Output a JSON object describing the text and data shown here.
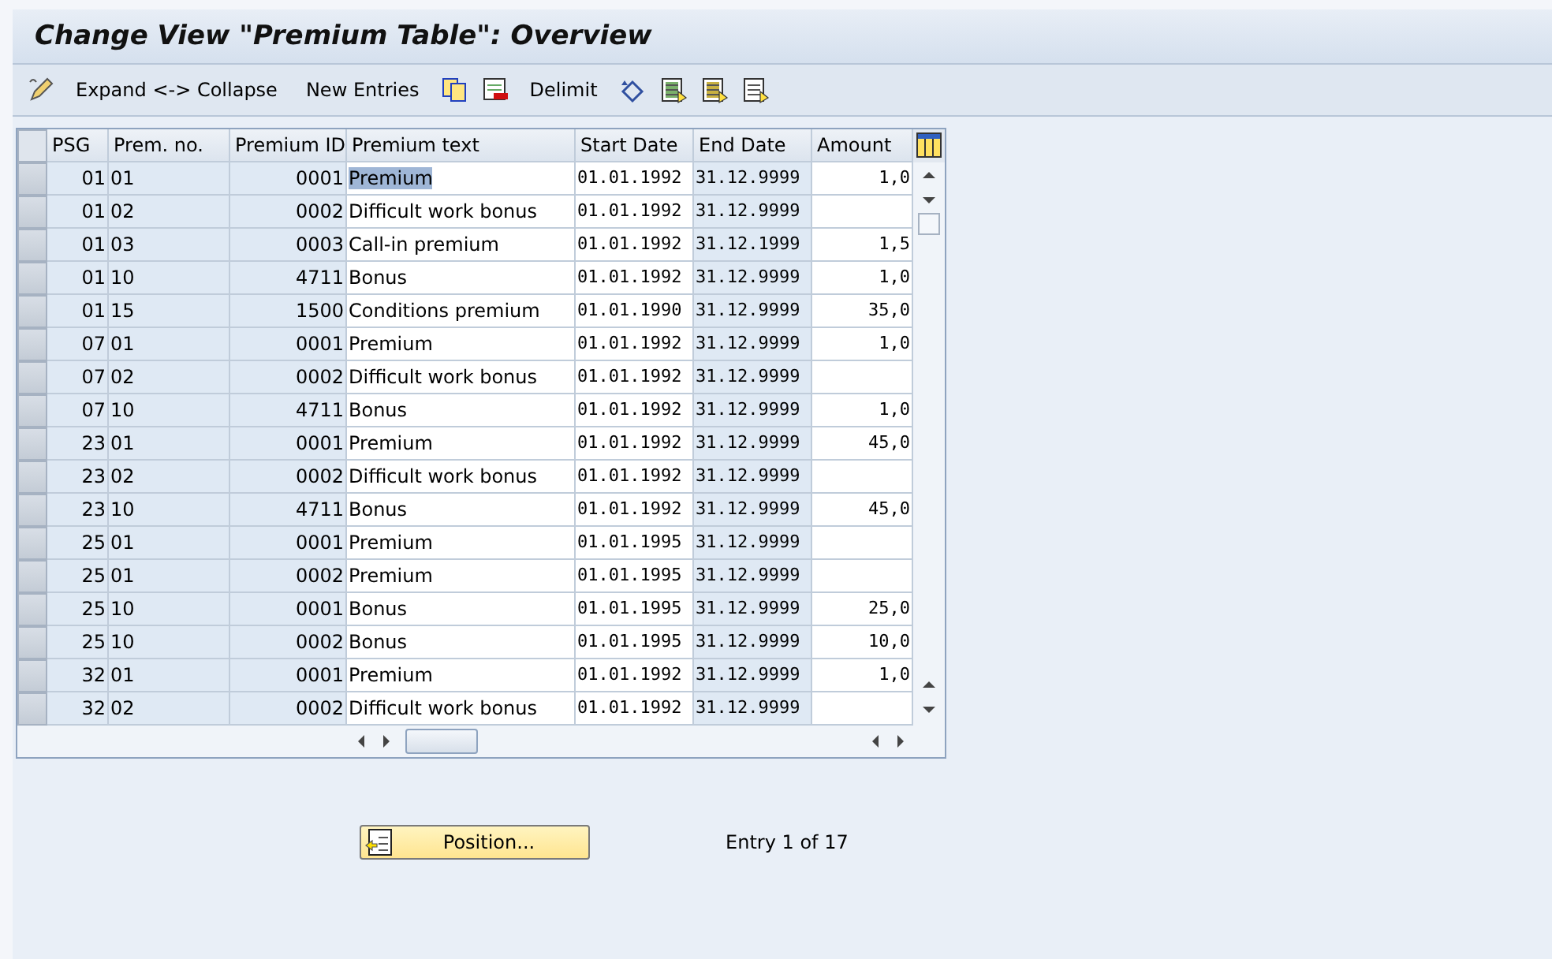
{
  "window": {
    "title": "Change View \"Premium Table\": Overview"
  },
  "toolbar": {
    "items": [
      {
        "kind": "icon"
      },
      {
        "kind": "text",
        "label": "Expand <-> Collapse"
      },
      {
        "kind": "text",
        "label": "New Entries"
      },
      {
        "kind": "icon"
      },
      {
        "kind": "icon"
      },
      {
        "kind": "text",
        "label": "Delimit"
      },
      {
        "kind": "icon"
      },
      {
        "kind": "icon"
      },
      {
        "kind": "icon"
      },
      {
        "kind": "icon"
      }
    ]
  },
  "table": {
    "columns": [
      {
        "label": "PSG"
      },
      {
        "label": "Prem. no."
      },
      {
        "label": "Premium ID"
      },
      {
        "label": "Premium text"
      },
      {
        "label": "Start Date"
      },
      {
        "label": "End Date"
      },
      {
        "label": "Amount"
      }
    ],
    "rows": [
      {
        "cells": [
          "01",
          "01",
          "0001",
          "Premium",
          "01.01.1992",
          "31.12.9999",
          "1,0"
        ],
        "highlighted": true
      },
      {
        "cells": [
          "01",
          "02",
          "0002",
          "Difficult work bonus",
          "01.01.1992",
          "31.12.9999",
          ""
        ],
        "highlighted": false
      },
      {
        "cells": [
          "01",
          "03",
          "0003",
          "Call-in premium",
          "01.01.1992",
          "31.12.1999",
          "1,5"
        ],
        "highlighted": false
      },
      {
        "cells": [
          "01",
          "10",
          "4711",
          "Bonus",
          "01.01.1992",
          "31.12.9999",
          "1,0"
        ],
        "highlighted": false
      },
      {
        "cells": [
          "01",
          "15",
          "1500",
          "Conditions premium",
          "01.01.1990",
          "31.12.9999",
          "35,0"
        ],
        "highlighted": false
      },
      {
        "cells": [
          "07",
          "01",
          "0001",
          "Premium",
          "01.01.1992",
          "31.12.9999",
          "1,0"
        ],
        "highlighted": false
      },
      {
        "cells": [
          "07",
          "02",
          "0002",
          "Difficult work bonus",
          "01.01.1992",
          "31.12.9999",
          ""
        ],
        "highlighted": false
      },
      {
        "cells": [
          "07",
          "10",
          "4711",
          "Bonus",
          "01.01.1992",
          "31.12.9999",
          "1,0"
        ],
        "highlighted": false
      },
      {
        "cells": [
          "23",
          "01",
          "0001",
          "Premium",
          "01.01.1992",
          "31.12.9999",
          "45,0"
        ],
        "highlighted": false
      },
      {
        "cells": [
          "23",
          "02",
          "0002",
          "Difficult work bonus",
          "01.01.1992",
          "31.12.9999",
          ""
        ],
        "highlighted": false
      },
      {
        "cells": [
          "23",
          "10",
          "4711",
          "Bonus",
          "01.01.1992",
          "31.12.9999",
          "45,0"
        ],
        "highlighted": false
      },
      {
        "cells": [
          "25",
          "01",
          "0001",
          "Premium",
          "01.01.1995",
          "31.12.9999",
          ""
        ],
        "highlighted": false
      },
      {
        "cells": [
          "25",
          "01",
          "0002",
          "Premium",
          "01.01.1995",
          "31.12.9999",
          ""
        ],
        "highlighted": false
      },
      {
        "cells": [
          "25",
          "10",
          "0001",
          "Bonus",
          "01.01.1995",
          "31.12.9999",
          "25,0"
        ],
        "highlighted": false
      },
      {
        "cells": [
          "25",
          "10",
          "0002",
          "Bonus",
          "01.01.1995",
          "31.12.9999",
          "10,0"
        ],
        "highlighted": false
      },
      {
        "cells": [
          "32",
          "01",
          "0001",
          "Premium",
          "01.01.1992",
          "31.12.9999",
          "1,0"
        ],
        "highlighted": false
      },
      {
        "cells": [
          "32",
          "02",
          "0002",
          "Difficult work bonus",
          "01.01.1992",
          "31.12.9999",
          ""
        ],
        "highlighted": false
      }
    ]
  },
  "position_button": {
    "label": "Position..."
  },
  "entry_info": "Entry 1 of 17"
}
